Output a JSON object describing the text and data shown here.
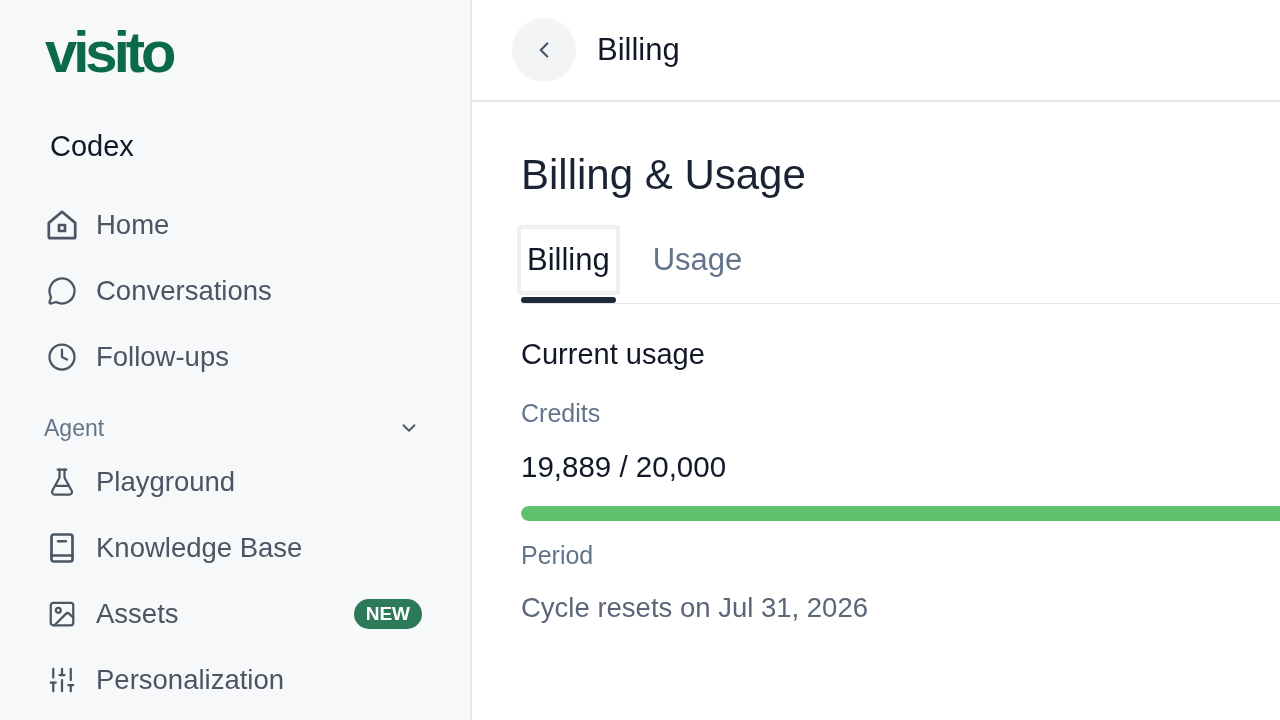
{
  "sidebar": {
    "logo": "visito",
    "workspace": "Codex",
    "items": [
      {
        "label": "Home",
        "selected": false
      },
      {
        "label": "Conversations",
        "selected": false
      },
      {
        "label": "Follow-ups",
        "selected": false
      }
    ],
    "sections": [
      {
        "title": "Agent",
        "expanded": true,
        "items": [
          {
            "label": "Playground",
            "selected": false
          },
          {
            "label": "Knowledge Base",
            "selected": false
          },
          {
            "label": "Assets",
            "selected": false,
            "badge": "NEW"
          },
          {
            "label": "Personalization",
            "selected": false
          }
        ]
      }
    ]
  },
  "header": {
    "title": "Billing"
  },
  "page": {
    "title": "Billing & Usage",
    "tabs": [
      {
        "label": "Billing",
        "selected": true
      },
      {
        "label": "Usage",
        "selected": false
      }
    ],
    "current_usage": {
      "title": "Current usage",
      "credits_label": "Credits",
      "credits_value": "19,889 / 20,000",
      "level": 0.994,
      "period_label": "Period",
      "period_value": "Cycle resets on Jul 31, 2026"
    }
  }
}
